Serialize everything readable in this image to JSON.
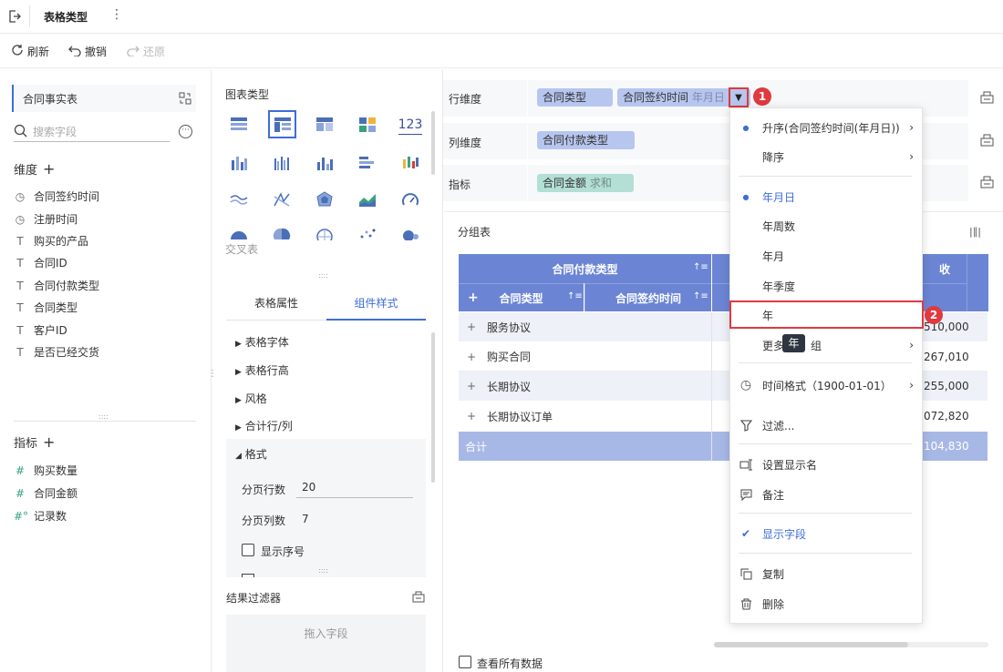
{
  "header": {
    "title": "表格类型"
  },
  "toolbar": {
    "refresh": "刷新",
    "undo": "撤销",
    "redo": "还原"
  },
  "left": {
    "table_name": "合同事实表",
    "search_placeholder": "搜索字段",
    "dimension_title": "维度",
    "dimensions": [
      {
        "icon": "clock-icon",
        "label": "合同签约时间"
      },
      {
        "icon": "clock-icon",
        "label": "注册时间"
      },
      {
        "icon": "text-icon",
        "label": "购买的产品"
      },
      {
        "icon": "text-icon",
        "label": "合同ID"
      },
      {
        "icon": "text-icon",
        "label": "合同付款类型"
      },
      {
        "icon": "text-icon",
        "label": "合同类型"
      },
      {
        "icon": "text-icon",
        "label": "客户ID"
      },
      {
        "icon": "text-icon",
        "label": "是否已经交货"
      }
    ],
    "measure_title": "指标",
    "measures": [
      {
        "icon": "hash-icon",
        "label": "购买数量"
      },
      {
        "icon": "hash-icon",
        "label": "合同金额"
      },
      {
        "icon": "calc-hash-icon",
        "label": "记录数"
      }
    ]
  },
  "middle": {
    "chart_type_title": "图表类型",
    "cross_table_label": "交叉表",
    "tabs": [
      "表格属性",
      "组件样式"
    ],
    "style_items": [
      "表格字体",
      "表格行高",
      "风格",
      "合计行/列",
      "格式"
    ],
    "format": {
      "page_rows_label": "分页行数",
      "page_rows_value": "20",
      "page_cols_label": "分页列数",
      "page_cols_value": "7",
      "show_index_label": "显示序号"
    },
    "result_filter_title": "结果过滤器",
    "drop_hint": "拖入字段"
  },
  "right": {
    "row_dim_label": "行维度",
    "row_pills": [
      "合同类型",
      "合同签约时间"
    ],
    "row_pill_suffix": "年月日",
    "col_dim_label": "列维度",
    "col_pills": [
      "合同付款类型"
    ],
    "metric_label": "指标",
    "metric_pill": "合同金额",
    "metric_pill_suffix": "求和",
    "table_title": "分组表",
    "table": {
      "header_top": "合同付款类型",
      "header_top_right": "收",
      "header_cols": [
        "合同类型",
        "合同签约时间"
      ],
      "rows": [
        {
          "label": "服务协议",
          "value": "510,000"
        },
        {
          "label": "购买合同",
          "value": "267,010"
        },
        {
          "label": "长期协议",
          "value": "255,000"
        },
        {
          "label": "长期协议订单",
          "value": "072,820"
        }
      ],
      "total_label": "合计",
      "total_value": "104,830"
    },
    "view_all_label": "查看所有数据",
    "badge_1": "1",
    "badge_2": "2"
  },
  "menu": {
    "asc": "升序(合同签约时间(年月日))",
    "desc": "降序",
    "granularity": [
      "年月日",
      "年周数",
      "年月",
      "年季度",
      "年"
    ],
    "more_prefix": "更多",
    "more_suffix": "组",
    "tooltip": "年",
    "time_format": "时间格式（1900-01-01）",
    "filter": "过滤...",
    "set_display_name": "设置显示名",
    "note": "备注",
    "show_field": "显示字段",
    "copy": "复制",
    "delete": "删除"
  },
  "colors": {
    "accent": "#3d6dd8",
    "header_blue": "#6b85d4",
    "pill_blue": "#b7c6ef",
    "pill_green": "#b3dfd5",
    "badge_red": "#e0393e"
  }
}
